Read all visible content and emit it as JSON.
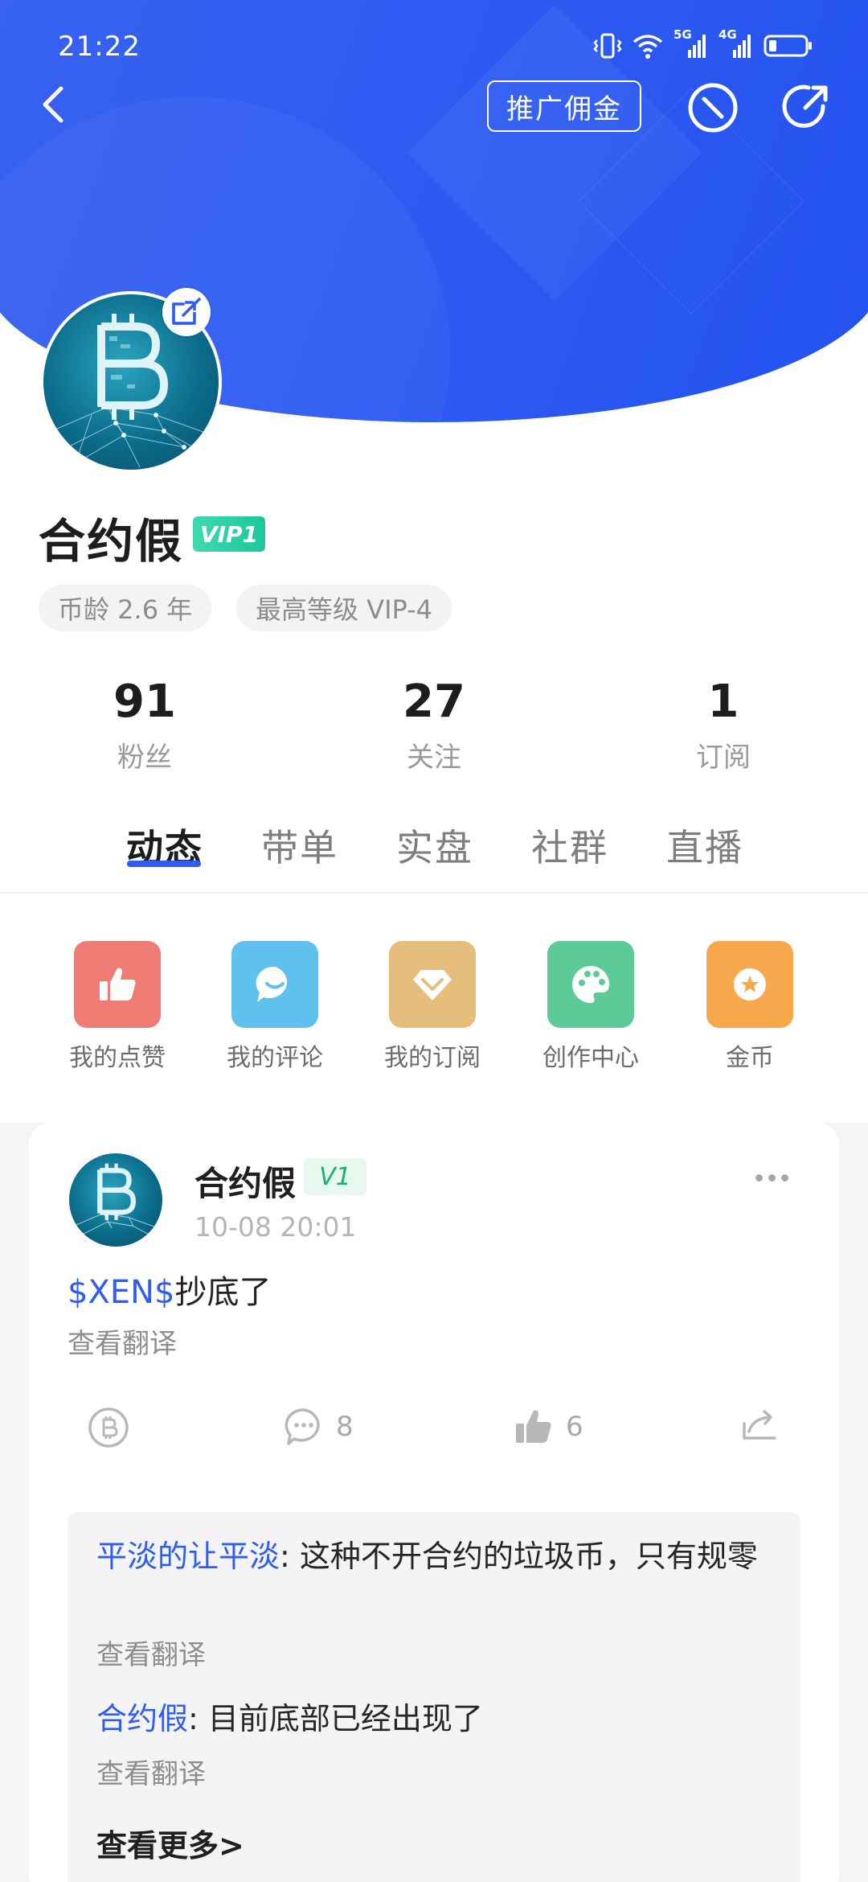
{
  "status_bar": {
    "time": "21:22",
    "network_1": "5G",
    "network_2": "4G"
  },
  "header": {
    "promo_label": "推广佣金"
  },
  "profile": {
    "name": "合约假",
    "vip_badge": "VIP1",
    "tags": [
      "币龄 2.6 年",
      "最高等级 VIP-4"
    ],
    "stats": [
      {
        "value": "91",
        "label": "粉丝"
      },
      {
        "value": "27",
        "label": "关注"
      },
      {
        "value": "1",
        "label": "订阅"
      }
    ]
  },
  "tabs": [
    {
      "label": "动态",
      "active": true
    },
    {
      "label": "带单",
      "active": false
    },
    {
      "label": "实盘",
      "active": false
    },
    {
      "label": "社群",
      "active": false
    },
    {
      "label": "直播",
      "active": false
    }
  ],
  "quick_actions": [
    {
      "label": "我的点赞",
      "icon": "thumbs-up-icon",
      "color": "#ee7b74"
    },
    {
      "label": "我的评论",
      "icon": "chat-bubble-icon",
      "color": "#5ec1ee"
    },
    {
      "label": "我的订阅",
      "icon": "diamond-icon",
      "color": "#e6be7c"
    },
    {
      "label": "创作中心",
      "icon": "palette-icon",
      "color": "#5ccb98"
    },
    {
      "label": "金币",
      "icon": "star-coin-icon",
      "color": "#f7a84d"
    }
  ],
  "post": {
    "author": "合约假",
    "level": "V1",
    "time": "10-08 20:01",
    "ticker": "$XEN$",
    "text": "抄底了",
    "translate": "查看翻译",
    "comment_count": "8",
    "like_count": "6"
  },
  "comments": [
    {
      "who": "平淡的让平淡",
      "text": ": 这种不开合约的垃圾币，只有规零",
      "translate": "查看翻译"
    },
    {
      "who": "合约假",
      "text": ": 目前底部已经出现了",
      "translate": "查看翻译"
    }
  ],
  "see_more": "查看更多>",
  "colors": {
    "brand_blue": "#2f5cf2",
    "vip_green": "#1cc79a"
  }
}
